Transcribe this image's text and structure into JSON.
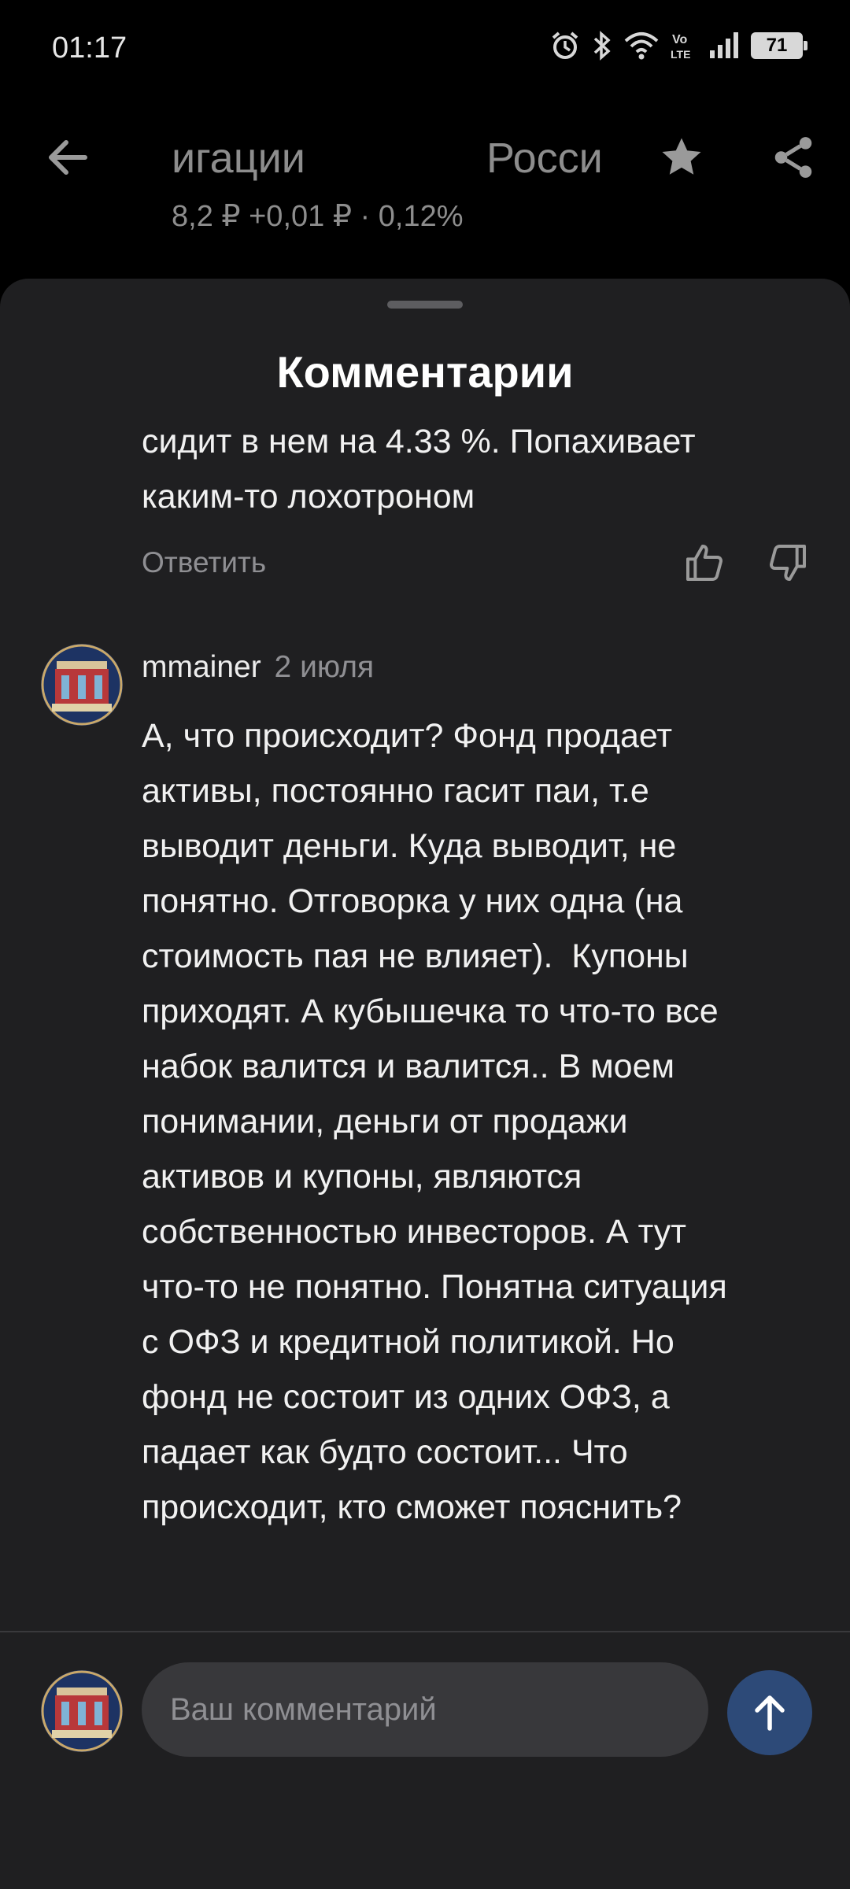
{
  "status_bar": {
    "time": "01:17",
    "battery": "71",
    "icons": [
      "alarm-icon",
      "bluetooth-icon",
      "wifi-icon",
      "volte-icon",
      "signal-icon",
      "battery-icon"
    ]
  },
  "header": {
    "title_left": "игации",
    "title_right": "Росси",
    "price_line": "8,2 ₽  +0,01 ₽ · 0,12%",
    "icons": [
      "back-arrow-icon",
      "star-icon",
      "share-icon"
    ]
  },
  "sheet": {
    "title": "Комментарии",
    "previous_comment": {
      "text": "сидит в нем на 4.33 %. Попахивает\nкаким-то лохотроном",
      "reply_label": "Ответить"
    },
    "comment": {
      "author": "mmainer",
      "date": "2 июля",
      "text": "А, что происходит? Фонд продает\nактивы, постоянно гасит паи, т.е\nвыводит деньги. Куда выводит, не\nпонятно. Отговорка у них одна (на\nстоимость пая не влияет).  Купоны\nприходят. А кубышечка то что-то все\nнабок валится и валится.. В моем\nпонимании, деньги от продажи\nактивов и купоны, являются\nсобственностью инвесторов. А тут\nчто-то не понятно. Понятна ситуация\nс ОФЗ и кредитной политикой. Но\nфонд не состоит из одних ОФЗ, а\nпадает как будто состоит... Что\nпроисходит, кто сможет пояснить?"
    }
  },
  "composer": {
    "placeholder": "Ваш комментарий",
    "value": ""
  },
  "colors": {
    "background": "#000000",
    "sheet": "#1f1f21",
    "input": "#38383b",
    "send_button": "#2d4a78",
    "muted_text": "#8f8f93"
  }
}
